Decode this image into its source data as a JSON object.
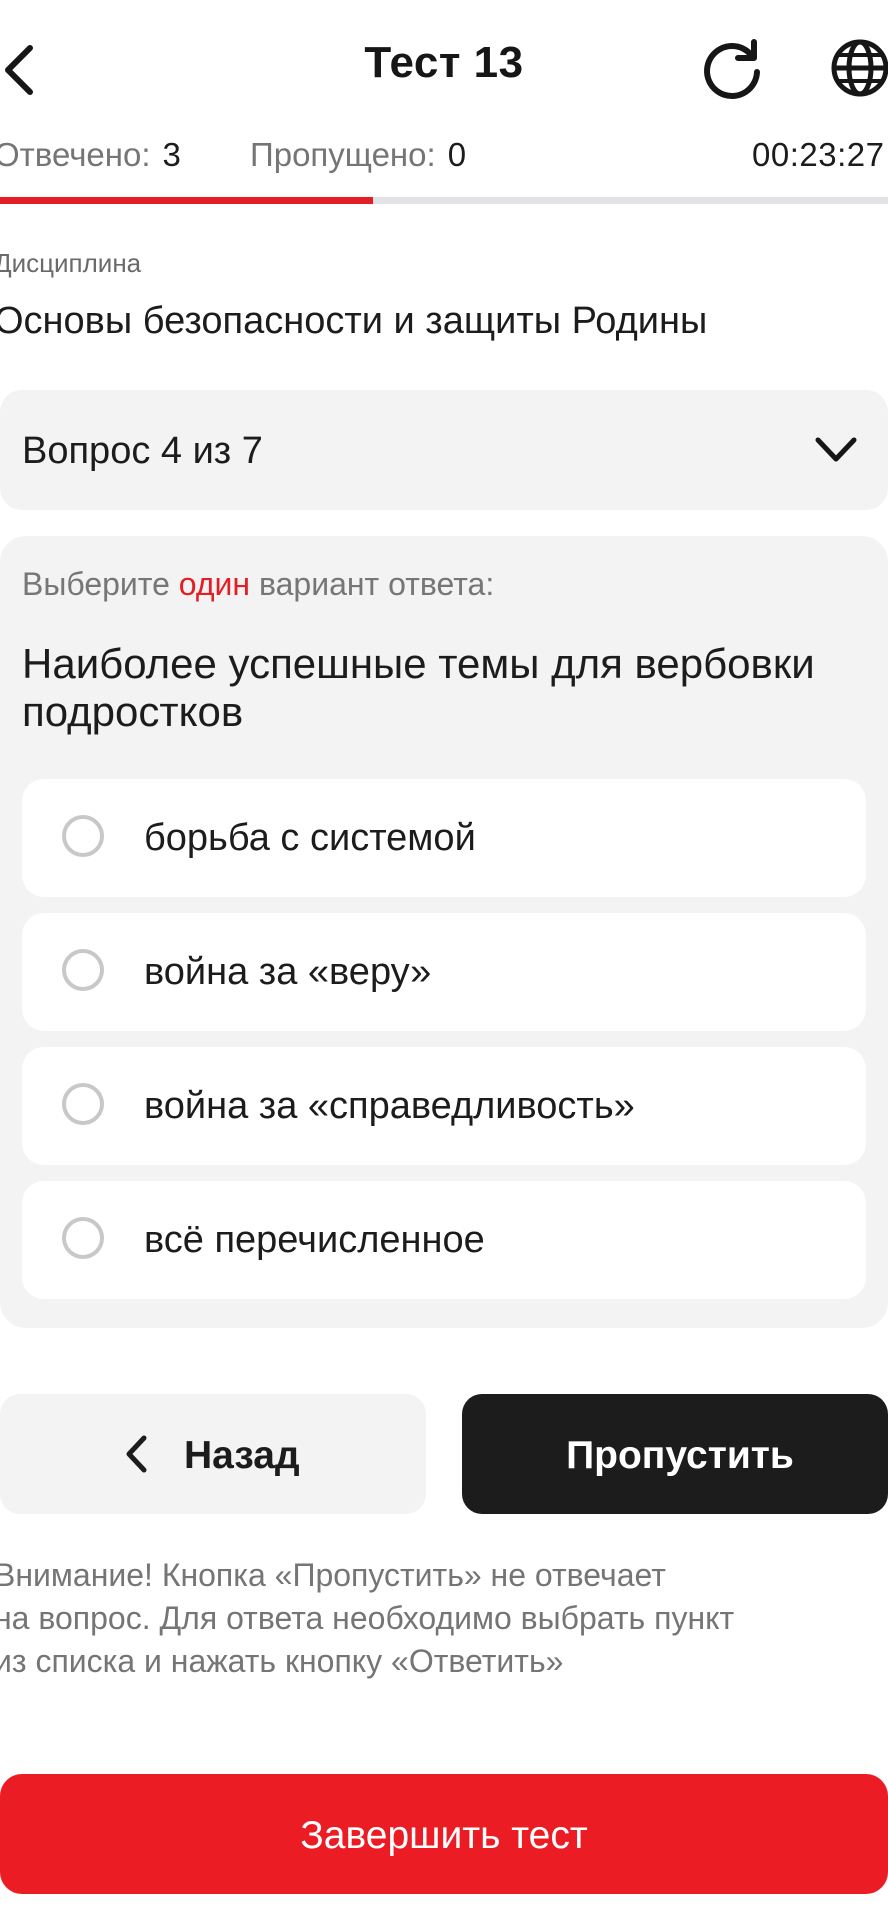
{
  "header": {
    "title": "Тест 13",
    "back_icon": "chevron-left-icon",
    "refresh_icon": "refresh-icon",
    "language_icon": "globe-icon"
  },
  "stats": {
    "answered_label": "Отвечено:",
    "answered_value": "3",
    "skipped_label": "Пропущено:",
    "skipped_value": "0",
    "timer": "00:23:27",
    "progress_fraction": 0.42
  },
  "discipline": {
    "label": "Дисциплина",
    "name": "Основы безопасности и защиты Родины"
  },
  "question_selector": {
    "label": "Вопрос 4 из 7",
    "icon": "chevron-down-icon"
  },
  "question": {
    "instruction_before": "Выберите ",
    "instruction_accent": "один",
    "instruction_after": " вариант ответа:",
    "text": "Наиболее успешные темы для вербовки подростков",
    "options": [
      {
        "label": "борьба с системой"
      },
      {
        "label": "война за «веру»"
      },
      {
        "label": "война за «справедливость»"
      },
      {
        "label": "всё перечисленное"
      }
    ]
  },
  "buttons": {
    "back_label": "Назад",
    "skip_label": "Пропустить",
    "finish_label": "Завершить тест"
  },
  "warning": {
    "line1": "Внимание! Кнопка «Пропустить» не отвечает",
    "line2": "на вопрос. Для ответа необходимо выбрать пункт",
    "line3": "из списка и нажать кнопку «Ответить»"
  },
  "colors": {
    "accent": "#e31e24",
    "finish_button": "#ec1c24",
    "dark_button": "#1c1c1c",
    "card_background": "#f3f3f4"
  }
}
